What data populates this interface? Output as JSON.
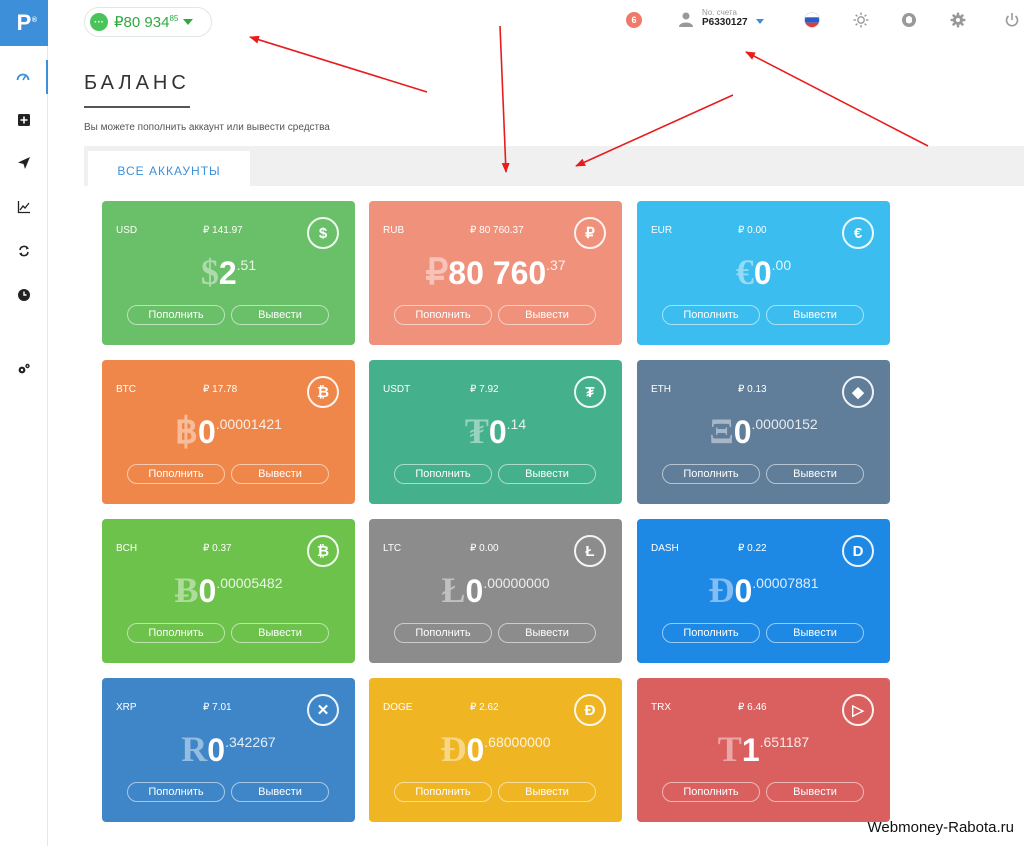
{
  "logo": {
    "text": "P",
    "mark": "®"
  },
  "header": {
    "balance_value": "₽80 934",
    "balance_cents": "85",
    "notifications": "6",
    "account_label": "No. счета",
    "account_number": "P6330127"
  },
  "page": {
    "title": "БАЛАНС",
    "subtitle": "Вы можете пополнить аккаунт или вывести средства",
    "tab": "ВСЕ АККАУНТЫ"
  },
  "buttons": {
    "deposit": "Пополнить",
    "withdraw": "Вывести"
  },
  "cards": [
    {
      "code": "USD",
      "rub": "₽ 141.97",
      "symbol": "$",
      "int": "2",
      "frac": ".51",
      "icon": "$",
      "color": "#6abf69"
    },
    {
      "code": "RUB",
      "rub": "₽ 80 760.37",
      "symbol": "₽",
      "int": "80 760",
      "frac": ".37",
      "icon": "₽",
      "color": "#f0917c"
    },
    {
      "code": "EUR",
      "rub": "₽ 0.00",
      "symbol": "€",
      "int": "0",
      "frac": ".00",
      "icon": "€",
      "color": "#3bbdef"
    },
    {
      "code": "BTC",
      "rub": "₽ 17.78",
      "symbol": "฿",
      "int": "0",
      "frac": ".00001421",
      "icon": "₿",
      "color": "#f0874a"
    },
    {
      "code": "USDT",
      "rub": "₽ 7.92",
      "symbol": "₮",
      "int": "0",
      "frac": ".14",
      "icon": "₮",
      "color": "#45b08c"
    },
    {
      "code": "ETH",
      "rub": "₽ 0.13",
      "symbol": "Ξ",
      "int": "0",
      "frac": ".00000152",
      "icon": "◆",
      "color": "#607d99"
    },
    {
      "code": "BCH",
      "rub": "₽ 0.37",
      "symbol": "Ƀ",
      "int": "0",
      "frac": ".00005482",
      "icon": "₿",
      "color": "#6cc24a"
    },
    {
      "code": "LTC",
      "rub": "₽ 0.00",
      "symbol": "Ł",
      "int": "0",
      "frac": ".00000000",
      "icon": "Ł",
      "color": "#8c8c8c"
    },
    {
      "code": "DASH",
      "rub": "₽ 0.22",
      "symbol": "Đ",
      "int": "0",
      "frac": ".00007881",
      "icon": "D",
      "color": "#1e88e5"
    },
    {
      "code": "XRP",
      "rub": "₽ 7.01",
      "symbol": "R",
      "int": "0",
      "frac": ".342267",
      "icon": "✕",
      "color": "#3f86c9"
    },
    {
      "code": "DOGE",
      "rub": "₽ 2.62",
      "symbol": "Đ",
      "int": "0",
      "frac": ".68000000",
      "icon": "Đ",
      "color": "#f0b522"
    },
    {
      "code": "TRX",
      "rub": "₽ 6.46",
      "symbol": "T",
      "int": "1",
      "frac": ".651187",
      "icon": "▷",
      "color": "#d9605f"
    }
  ],
  "watermark": "Webmoney-Rabota.ru"
}
